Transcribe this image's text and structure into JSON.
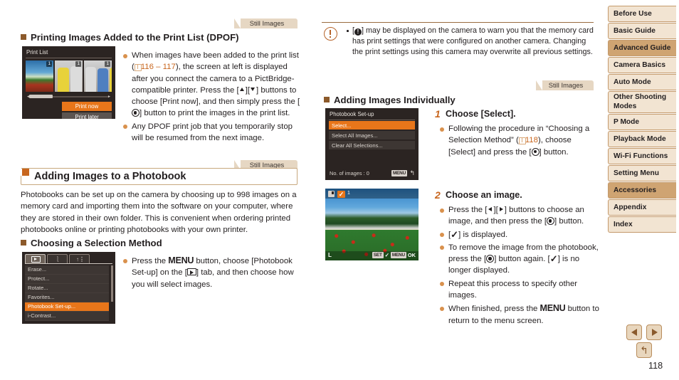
{
  "page": {
    "number": "118"
  },
  "left_column": {
    "tab_still_images_1": "Still Images",
    "heading_dpof": "Printing Images Added to the Print List (DPOF)",
    "screen_print_list": {
      "title": "Print List",
      "thumb_counts": [
        "1",
        "1",
        "1"
      ],
      "button_print_now": "Print now",
      "button_print_later": "Print later"
    },
    "bullets": [
      {
        "parts": [
          "When images have been added to the print list (",
          "116",
          " – ",
          "117",
          "), the screen at left is displayed after you connect the camera to a PictBridge-compatible printer. Press the [",
          "up",
          "][",
          "down",
          "] buttons to choose [Print now], and then simply press the [",
          "func",
          "] button to print the images in the print list."
        ]
      },
      {
        "text": "Any DPOF print job that you temporarily stop will be resumed from the next image."
      }
    ],
    "tab_still_images_2": "Still Images",
    "heading_photobook": "Adding Images to a Photobook",
    "intro_paragraph": "Photobooks can be set up on the camera by choosing up to 998 images on a memory card and importing them into the software on your computer, where they are stored in their own folder. This is convenient when ordering printed photobooks online or printing photobooks with your own printer.",
    "heading_selection_method": "Choosing a Selection Method",
    "screen_menu": {
      "tabs": [
        "playback-tab",
        "print-tab",
        "settings-tab"
      ],
      "rows": [
        "Erase...",
        "Protect...",
        "Rotate...",
        "Favorites...",
        "Photobook Set-up...",
        "i-Contrast..."
      ],
      "selected_row": "Photobook Set-up..."
    },
    "bullet_selection": {
      "seg1": "Press the ",
      "menu": "MENU",
      "seg2": " button, choose [Photobook Set-up] on the [",
      "seg3": "] tab, and then choose how you will select images."
    }
  },
  "middle_column": {
    "note": {
      "lead": "[",
      "warn_glyph": "!",
      "text": "] may be displayed on the camera to warn you that the memory card has print settings that were configured on another camera. Changing the print settings using this camera may overwrite all previous settings."
    },
    "tab_still_images": "Still Images",
    "heading_adding_individually": "Adding Images Individually",
    "screen_photobook_setup": {
      "title": "Photobook Set-up",
      "rows": [
        "Select...",
        "Select All Images...",
        "Clear All Selections..."
      ],
      "selected_row": "Select...",
      "footer": "No. of images : 0",
      "badge_menu": "MENU",
      "badge_back": "↰"
    },
    "step1": {
      "number": "1",
      "title": "Choose [Select].",
      "bullet_seg1": "Following the procedure in “Choosing a Selection Method” (",
      "bullet_ref": "118",
      "bullet_seg2": "), choose [Select] and press the [",
      "bullet_seg3": "] button."
    },
    "screen_image_review": {
      "check_mark": "✓",
      "count": "1",
      "size_label": "L",
      "badge_set": "SET",
      "badge_check": "✓",
      "badge_menu": "MENU",
      "badge_ok": "OK"
    },
    "step2": {
      "number": "2",
      "title": "Choose an image.",
      "bullets": [
        {
          "seg1": "Press the [",
          "seg2": "][",
          "seg3": "] buttons to choose an image, and then press the [",
          "seg4": "] button."
        },
        {
          "seg1": "[",
          "check": "✓",
          "seg2": "] is displayed."
        },
        {
          "seg1": "To remove the image from the photobook, press the [",
          "seg2": "] button again. [",
          "check": "✓",
          "seg3": "] is no longer displayed."
        },
        {
          "text": "Repeat this process to specify other images."
        },
        {
          "seg1": "When finished, press the ",
          "menu": "MENU",
          "seg2": " button to return to the menu screen."
        }
      ]
    }
  },
  "sidebar": {
    "items": [
      {
        "label": "Before Use",
        "highlighted": false
      },
      {
        "label": "Basic Guide",
        "highlighted": false
      },
      {
        "label": "Advanced Guide",
        "highlighted": true
      },
      {
        "label": "Camera Basics",
        "highlighted": false
      },
      {
        "label": "Auto Mode",
        "highlighted": false
      },
      {
        "label": "Other Shooting Modes",
        "highlighted": false
      },
      {
        "label": "P Mode",
        "highlighted": false
      },
      {
        "label": "Playback Mode",
        "highlighted": false
      },
      {
        "label": "Wi-Fi Functions",
        "highlighted": false
      },
      {
        "label": "Setting Menu",
        "highlighted": false
      },
      {
        "label": "Accessories",
        "highlighted": true
      },
      {
        "label": "Appendix",
        "highlighted": false
      },
      {
        "label": "Index",
        "highlighted": false
      }
    ]
  },
  "footer_nav": {
    "prev": "previous-page",
    "next": "next-page",
    "home": "↰"
  },
  "colors": {
    "accent_orange": "#c8661e",
    "menu_highlight": "#e8761a",
    "tab_bg": "#e6d7c3",
    "nav_bg": "#f2e4d2",
    "nav_highlight": "#cfa472",
    "nav_border": "#c49a6c",
    "text": "#231f20"
  }
}
